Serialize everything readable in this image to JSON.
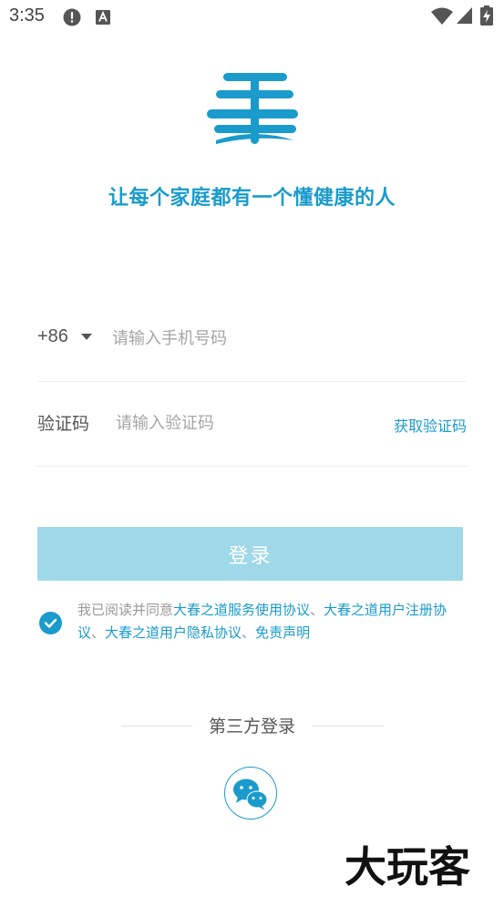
{
  "status_bar": {
    "time": "3:35"
  },
  "brand": {
    "slogan": "让每个家庭都有一个懂健康的人",
    "accent_color": "#1a9bcc"
  },
  "phone": {
    "country_code": "+86",
    "placeholder": "请输入手机号码"
  },
  "verification": {
    "label": "验证码",
    "placeholder": "请输入验证码",
    "get_code_label": "获取验证码"
  },
  "login_button": {
    "label": "登录",
    "color": "#9fd8e9"
  },
  "agreement": {
    "prefix": "我已阅读并同意",
    "links": [
      "大春之道服务使用协议",
      "大春之道用户注册协议",
      "大春之道用户隐私协议",
      "免责声明"
    ],
    "separator": "、",
    "checked": true
  },
  "third_party": {
    "title": "第三方登录",
    "options": [
      {
        "icon": "wechat-icon"
      }
    ]
  },
  "watermark": "大玩客"
}
